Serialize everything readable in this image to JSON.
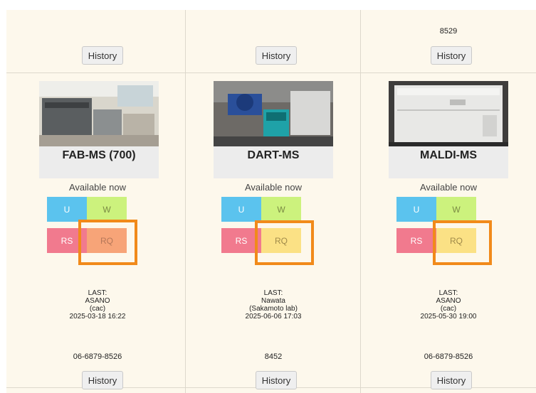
{
  "top_row": [
    {
      "phone": "",
      "history_label": "History"
    },
    {
      "phone": "",
      "history_label": "History"
    },
    {
      "phone": "8529",
      "history_label": "History"
    }
  ],
  "instruments": [
    {
      "name": "FAB-MS (700)",
      "status": "Available now",
      "tiles": {
        "u": "U",
        "w": "W",
        "rs": "RS",
        "rq": "RQ"
      },
      "rq_color": "#f7a478",
      "last": {
        "label": "LAST:",
        "user": "ASANO",
        "group": "(cac)",
        "datetime": "2025-03-18 16:22"
      },
      "phone": "06-6879-8526",
      "history_label": "History"
    },
    {
      "name": "DART-MS",
      "status": "Available now",
      "tiles": {
        "u": "U",
        "w": "W",
        "rs": "RS",
        "rq": "RQ"
      },
      "rq_color": "#fbe185",
      "last": {
        "label": "LAST:",
        "user": "Nawata",
        "group": "(Sakamoto lab)",
        "datetime": "2025-06-06 17:03"
      },
      "phone": "8452",
      "history_label": "History"
    },
    {
      "name": "MALDI-MS",
      "status": "Available now",
      "tiles": {
        "u": "U",
        "w": "W",
        "rs": "RS",
        "rq": "RQ"
      },
      "rq_color": "#fbe185",
      "last": {
        "label": "LAST:",
        "user": "ASANO",
        "group": "(cac)",
        "datetime": "2025-05-30 19:00"
      },
      "phone": "06-6879-8526",
      "history_label": "History"
    }
  ],
  "colors": {
    "highlight": "#f18a1a",
    "u": "#5bc3ee",
    "w": "#ccf27d",
    "rs": "#f17a8e"
  }
}
